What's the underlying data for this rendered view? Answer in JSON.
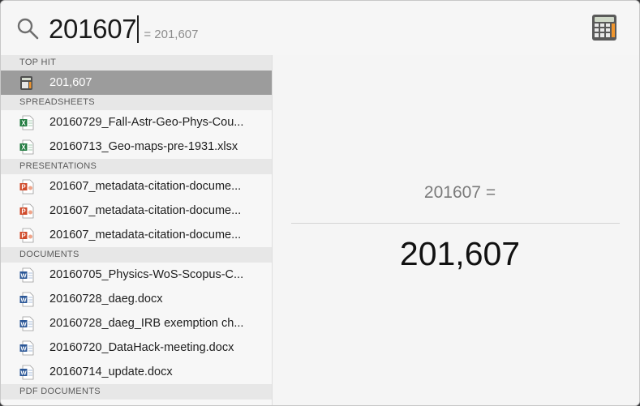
{
  "search": {
    "query": "201607",
    "inline_result": "= 201,607"
  },
  "sections": [
    {
      "title": "TOP HIT",
      "items": [
        {
          "label": "201,607",
          "icon": "calculator-icon",
          "selected": true
        }
      ]
    },
    {
      "title": "SPREADSHEETS",
      "items": [
        {
          "label": "20160729_Fall-Astr-Geo-Phys-Cou...",
          "icon": "excel-file-icon"
        },
        {
          "label": "20160713_Geo-maps-pre-1931.xlsx",
          "icon": "excel-file-icon"
        }
      ]
    },
    {
      "title": "PRESENTATIONS",
      "items": [
        {
          "label": "201607_metadata-citation-docume...",
          "icon": "powerpoint-file-icon"
        },
        {
          "label": "201607_metadata-citation-docume...",
          "icon": "powerpoint-file-icon"
        },
        {
          "label": "201607_metadata-citation-docume...",
          "icon": "powerpoint-file-icon"
        }
      ]
    },
    {
      "title": "DOCUMENTS",
      "items": [
        {
          "label": "20160705_Physics-WoS-Scopus-C...",
          "icon": "word-file-icon"
        },
        {
          "label": "20160728_daeg.docx",
          "icon": "word-file-icon"
        },
        {
          "label": "20160728_daeg_IRB exemption ch...",
          "icon": "word-file-icon"
        },
        {
          "label": "20160720_DataHack-meeting.docx",
          "icon": "word-file-icon"
        },
        {
          "label": "20160714_update.docx",
          "icon": "word-file-icon"
        }
      ]
    },
    {
      "title": "PDF DOCUMENTS",
      "items": []
    }
  ],
  "preview": {
    "expression": "201607 =",
    "result": "201,607"
  },
  "colors": {
    "selected_row": "#9c9c9c",
    "excel": "#1f7a3e",
    "powerpoint": "#d04a2a",
    "word": "#2b5797"
  }
}
